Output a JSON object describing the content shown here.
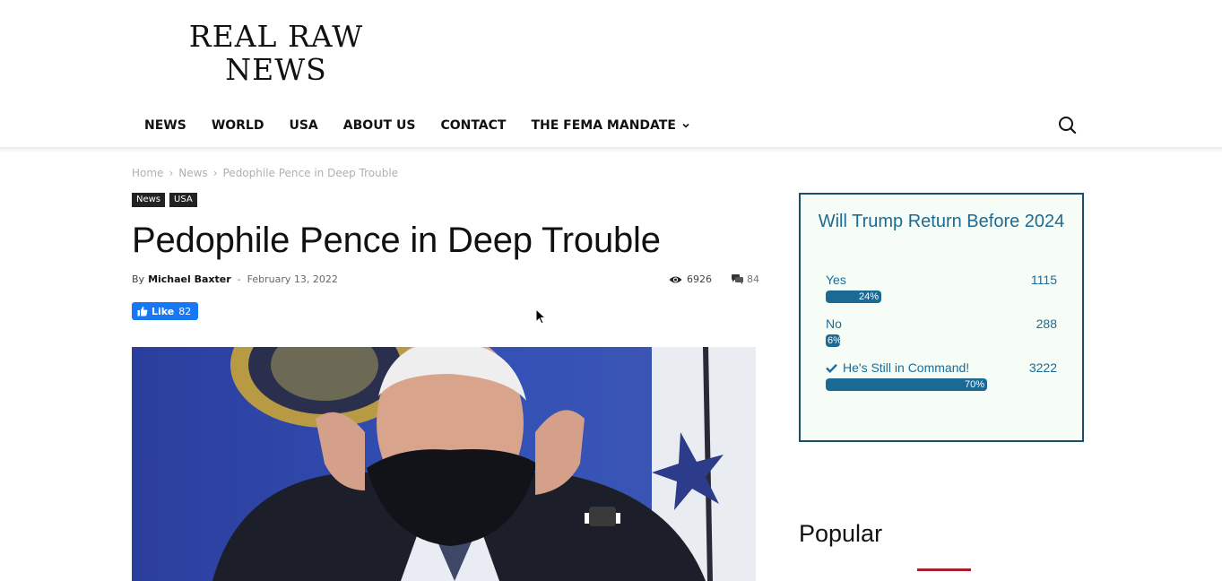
{
  "site": {
    "logo_line1": "REAL RAW",
    "logo_line2": "NEWS"
  },
  "nav": {
    "items": [
      "NEWS",
      "WORLD",
      "USA",
      "ABOUT US",
      "CONTACT",
      "THE FEMA MANDATE"
    ],
    "search_icon": "search-icon"
  },
  "breadcrumb": {
    "home": "Home",
    "section": "News",
    "current": "Pedophile Pence in Deep Trouble"
  },
  "categories": [
    "News",
    "USA"
  ],
  "article": {
    "title": "Pedophile Pence in Deep Trouble",
    "by": "By",
    "author": "Michael Baxter",
    "dash": "-",
    "date": "February 13, 2022",
    "views": "6926",
    "comments": "84"
  },
  "like_button": {
    "label": "Like",
    "count": "82"
  },
  "poll": {
    "question": "Will Trump Return Before 2024",
    "options": [
      {
        "label": "Yes",
        "votes": "1115",
        "percent_text": "24%",
        "percent": 24,
        "checked": false
      },
      {
        "label": "No",
        "votes": "288",
        "percent_text": "6%",
        "percent": 6,
        "checked": false
      },
      {
        "label": "He's Still in Command!",
        "votes": "3222",
        "percent_text": "70%",
        "percent": 70,
        "checked": true
      }
    ],
    "accent": "#1a6a94"
  },
  "sidebar": {
    "popular_heading": "Popular"
  },
  "colors": {
    "facebook_blue": "#1877f2",
    "popular_accent": "#a81e2e"
  }
}
